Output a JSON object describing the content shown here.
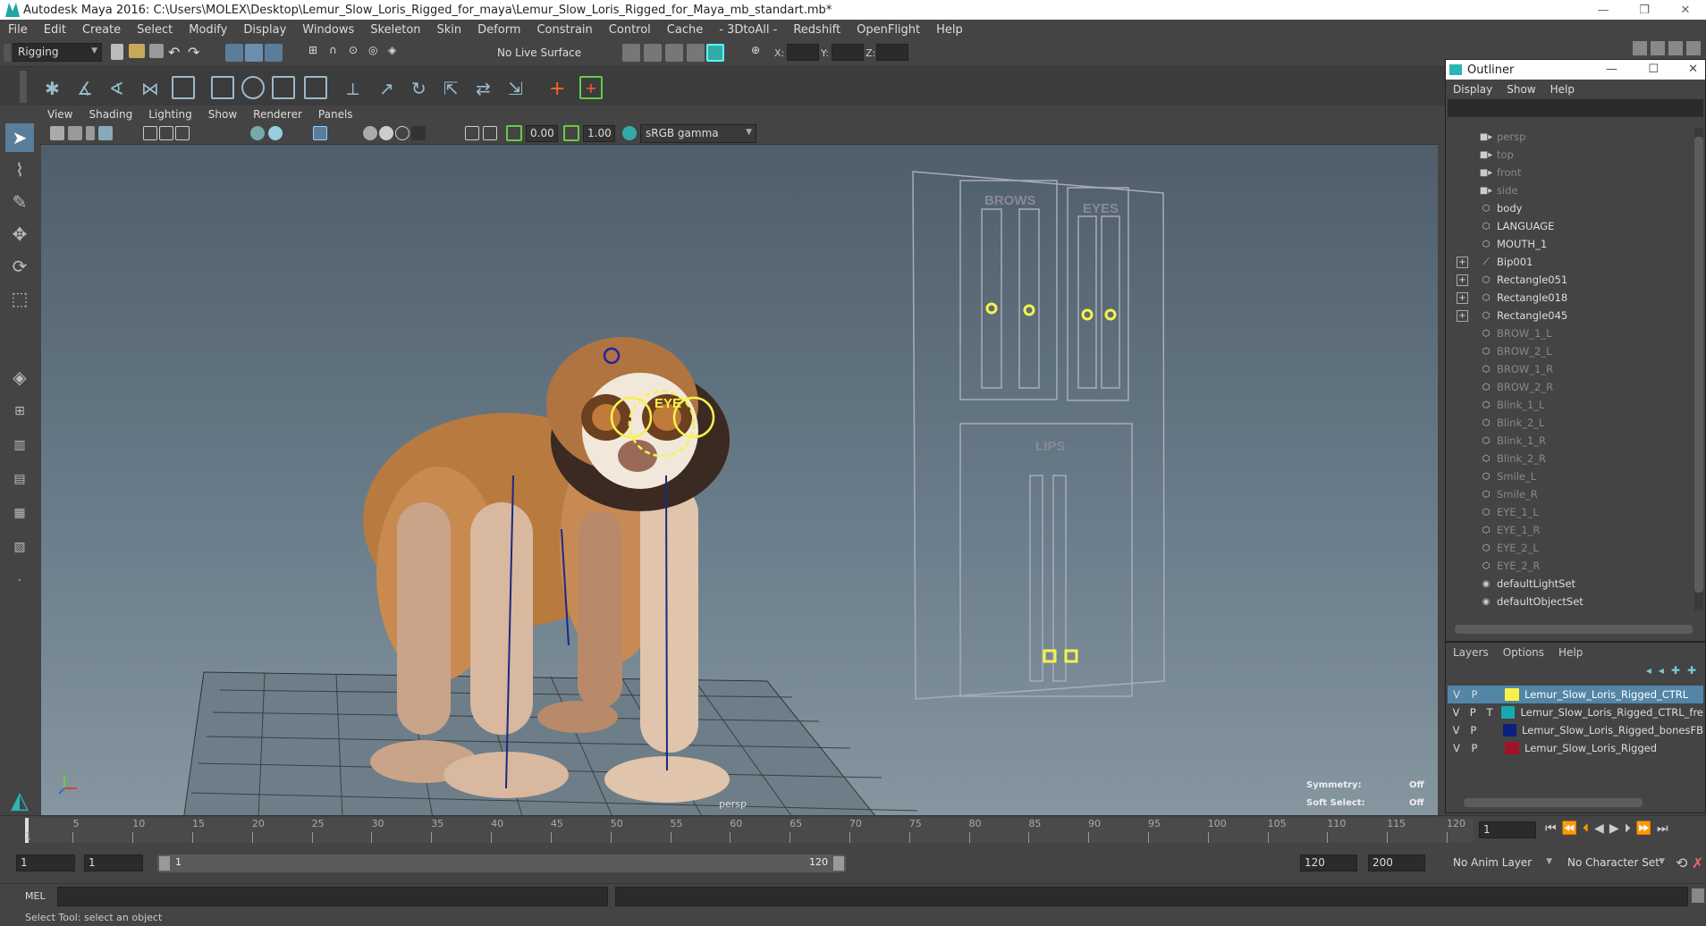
{
  "window": {
    "title": "Autodesk Maya 2016: C:\\Users\\MOLEX\\Desktop\\Lemur_Slow_Loris_Rigged_for_maya\\Lemur_Slow_Loris_Rigged_for_Maya_mb_standart.mb*"
  },
  "menubar": [
    "File",
    "Edit",
    "Create",
    "Select",
    "Modify",
    "Display",
    "Windows",
    "Skeleton",
    "Skin",
    "Deform",
    "Constrain",
    "Control",
    "Cache",
    "- 3DtoAll -",
    "Redshift",
    "OpenFlight",
    "Help"
  ],
  "statusline": {
    "mode": "Rigging",
    "live_surface": "No Live Surface",
    "x_label": "X:",
    "y_label": "Y:",
    "z_label": "Z:"
  },
  "viewport": {
    "menu": [
      "View",
      "Shading",
      "Lighting",
      "Show",
      "Renderer",
      "Panels"
    ],
    "exposure": "0.00",
    "gamma": "1.00",
    "colorspace": "sRGB gamma",
    "camera_label": "persp",
    "symmetry_label": "Symmetry:",
    "symmetry_value": "Off",
    "soft_select_label": "Soft Select:",
    "soft_select_value": "Off",
    "eye_label": "EYE",
    "brows_label": "BROWS",
    "eyes_label": "EYES",
    "lips_label": "LIPS"
  },
  "outliner": {
    "title": "Outliner",
    "menu": [
      "Display",
      "Show",
      "Help"
    ],
    "items": [
      {
        "label": "persp",
        "type": "camera",
        "dim": true,
        "expand": false
      },
      {
        "label": "top",
        "type": "camera",
        "dim": true,
        "expand": false
      },
      {
        "label": "front",
        "type": "camera",
        "dim": true,
        "expand": false
      },
      {
        "label": "side",
        "type": "camera",
        "dim": true,
        "expand": false
      },
      {
        "label": "body",
        "type": "mesh",
        "dim": false,
        "expand": false
      },
      {
        "label": "LANGUAGE",
        "type": "mesh",
        "dim": false,
        "expand": false
      },
      {
        "label": "MOUTH_1",
        "type": "mesh",
        "dim": false,
        "expand": false
      },
      {
        "label": "Bip001",
        "type": "joint",
        "dim": false,
        "expand": true
      },
      {
        "label": "Rectangle051",
        "type": "mesh",
        "dim": false,
        "expand": true
      },
      {
        "label": "Rectangle018",
        "type": "mesh",
        "dim": false,
        "expand": true
      },
      {
        "label": "Rectangle045",
        "type": "mesh",
        "dim": false,
        "expand": true
      },
      {
        "label": "BROW_1_L",
        "type": "mesh",
        "dim": true,
        "expand": false
      },
      {
        "label": "BROW_2_L",
        "type": "mesh",
        "dim": true,
        "expand": false
      },
      {
        "label": "BROW_1_R",
        "type": "mesh",
        "dim": true,
        "expand": false
      },
      {
        "label": "BROW_2_R",
        "type": "mesh",
        "dim": true,
        "expand": false
      },
      {
        "label": "Blink_1_L",
        "type": "mesh",
        "dim": true,
        "expand": false
      },
      {
        "label": "Blink_2_L",
        "type": "mesh",
        "dim": true,
        "expand": false
      },
      {
        "label": "Blink_1_R",
        "type": "mesh",
        "dim": true,
        "expand": false
      },
      {
        "label": "Blink_2_R",
        "type": "mesh",
        "dim": true,
        "expand": false
      },
      {
        "label": "Smile_L",
        "type": "mesh",
        "dim": true,
        "expand": false
      },
      {
        "label": "Smile_R",
        "type": "mesh",
        "dim": true,
        "expand": false
      },
      {
        "label": "EYE_1_L",
        "type": "mesh",
        "dim": true,
        "expand": false
      },
      {
        "label": "EYE_1_R",
        "type": "mesh",
        "dim": true,
        "expand": false
      },
      {
        "label": "EYE_2_L",
        "type": "mesh",
        "dim": true,
        "expand": false
      },
      {
        "label": "EYE_2_R",
        "type": "mesh",
        "dim": true,
        "expand": false
      },
      {
        "label": "defaultLightSet",
        "type": "set",
        "dim": false,
        "expand": false
      },
      {
        "label": "defaultObjectSet",
        "type": "set",
        "dim": false,
        "expand": false
      }
    ]
  },
  "layers": {
    "menu": [
      "Layers",
      "Options",
      "Help"
    ],
    "rows": [
      {
        "v": "V",
        "p": "P",
        "t": "",
        "color": "#f7f24a",
        "name": "Lemur_Slow_Loris_Rigged_CTRL",
        "selected": true
      },
      {
        "v": "V",
        "p": "P",
        "t": "T",
        "color": "#1aa8b0",
        "name": "Lemur_Slow_Loris_Rigged_CTRL_fre",
        "selected": false
      },
      {
        "v": "V",
        "p": "P",
        "t": "",
        "color": "#0a1f80",
        "name": "Lemur_Slow_Loris_Rigged_bonesFB",
        "selected": false
      },
      {
        "v": "V",
        "p": "P",
        "t": "",
        "color": "#a0122a",
        "name": "Lemur_Slow_Loris_Rigged",
        "selected": false
      }
    ]
  },
  "timeline": {
    "ticks": [
      "5",
      "10",
      "15",
      "20",
      "25",
      "30",
      "35",
      "40",
      "45",
      "50",
      "55",
      "60",
      "65",
      "70",
      "75",
      "80",
      "85",
      "90",
      "95",
      "100",
      "105",
      "110",
      "115",
      "120"
    ],
    "start_tick": "1",
    "current_frame": "1"
  },
  "range": {
    "start": "1",
    "playback_start": "1",
    "slider_start": "1",
    "slider_end": "120",
    "playback_end": "120",
    "end": "200",
    "anim_layer": "No Anim Layer",
    "character_set": "No Character Set"
  },
  "cmdline": {
    "label": "MEL"
  },
  "helpline": {
    "text": "Select Tool: select an object"
  },
  "colors": {
    "accent": "#5285a6",
    "control_yellow": "#f7f24a"
  }
}
